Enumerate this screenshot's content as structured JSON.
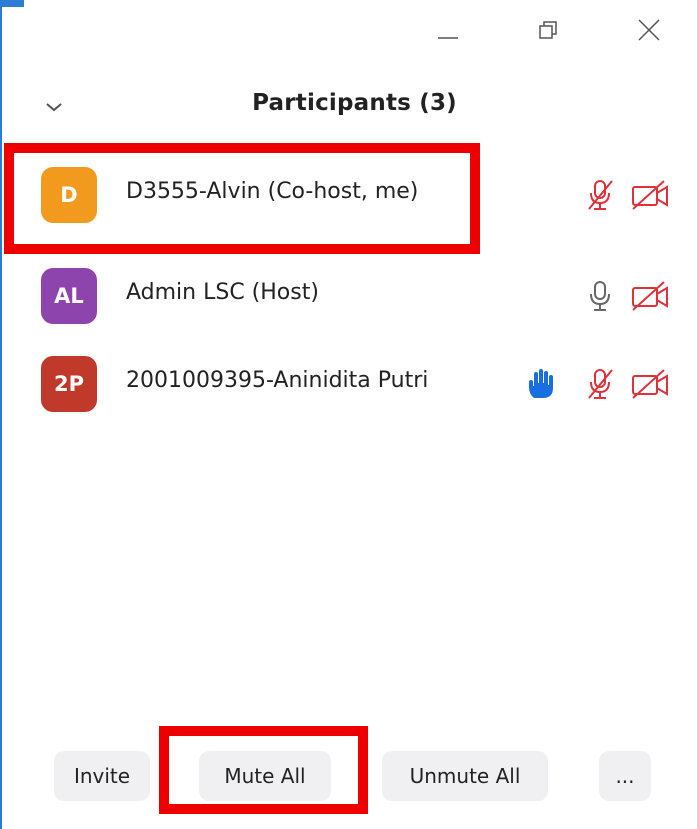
{
  "window": {
    "title": "Participants (3)",
    "controls": {
      "minimize_icon": "minimize-icon",
      "restore_icon": "restore-icon",
      "close_icon": "close-icon"
    }
  },
  "participants": [
    {
      "initials": "D",
      "name": "D3555-Alvin (Co-host, me)",
      "avatar_color": "#f29a1e",
      "hand_raised": false,
      "mic": "muted",
      "video": "off"
    },
    {
      "initials": "AL",
      "name": "Admin LSC (Host)",
      "avatar_color": "#8e44ad",
      "hand_raised": false,
      "mic": "on",
      "video": "off"
    },
    {
      "initials": "2P",
      "name": "2001009395-Aninidita Putri",
      "avatar_color": "#c0392b",
      "hand_raised": true,
      "mic": "muted",
      "video": "off"
    }
  ],
  "footer": {
    "invite_label": "Invite",
    "mute_all_label": "Mute All",
    "unmute_all_label": "Unmute All",
    "more_label": "..."
  },
  "colors": {
    "muted_red": "#e0303a",
    "hand_blue": "#1a6fe0",
    "highlight_red": "#ee0000",
    "window_accent": "#2b7cd3"
  }
}
